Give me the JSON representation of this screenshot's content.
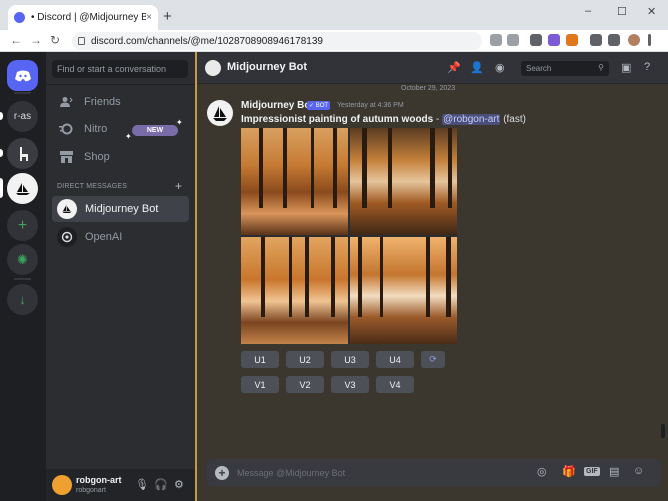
{
  "browser": {
    "tab_title": "• Discord | @Midjourney Bot",
    "tab_close": "×",
    "new_tab": "+",
    "url": "discord.com/channels/@me/1028708908946178139",
    "win_min": "–",
    "win_max": "☐",
    "win_close": "✕",
    "back": "←",
    "forward": "→",
    "reload": "↻"
  },
  "guilds": [
    {
      "label": ""
    },
    {
      "label": "r-as"
    },
    {
      "label": ""
    },
    {
      "label": ""
    },
    {
      "label": "+"
    },
    {
      "label": "✺"
    },
    {
      "label": "↓"
    }
  ],
  "sidebar": {
    "search_placeholder": "Find or start a conversation",
    "nav": [
      {
        "label": "Friends",
        "icon": "friends-icon"
      },
      {
        "label": "Nitro",
        "icon": "nitro-icon"
      },
      {
        "label": "Shop",
        "icon": "shop-icon"
      }
    ],
    "nitro_badge": "NEW",
    "dm_header": "DIRECT MESSAGES",
    "dm_add": "+",
    "dms": [
      {
        "label": "Midjourney Bot",
        "active": true
      },
      {
        "label": "OpenAI",
        "active": false
      }
    ]
  },
  "user": {
    "name": "robgon-art",
    "tag": "robgonart"
  },
  "header": {
    "title": "Midjourney Bot",
    "search_placeholder": "Search"
  },
  "message": {
    "date": "October 29, 2023",
    "author": "Midjourney Bot",
    "bot_tag": "✓ BOT",
    "time": "Yesterday at 4:36 PM",
    "prompt": "Impressionist painting of autumn woods",
    "separator": " - ",
    "mention": "@robgon-art",
    "speed": " (fast)"
  },
  "buttons": {
    "upscale": [
      "U1",
      "U2",
      "U3",
      "U4"
    ],
    "variation": [
      "V1",
      "V2",
      "V3",
      "V4"
    ],
    "refresh": "⟳"
  },
  "composer": {
    "placeholder": "Message @Midjourney Bot",
    "gif": "GIF"
  },
  "colors": {
    "accent": "#5865f2",
    "highlight_border": "#c59a43"
  }
}
